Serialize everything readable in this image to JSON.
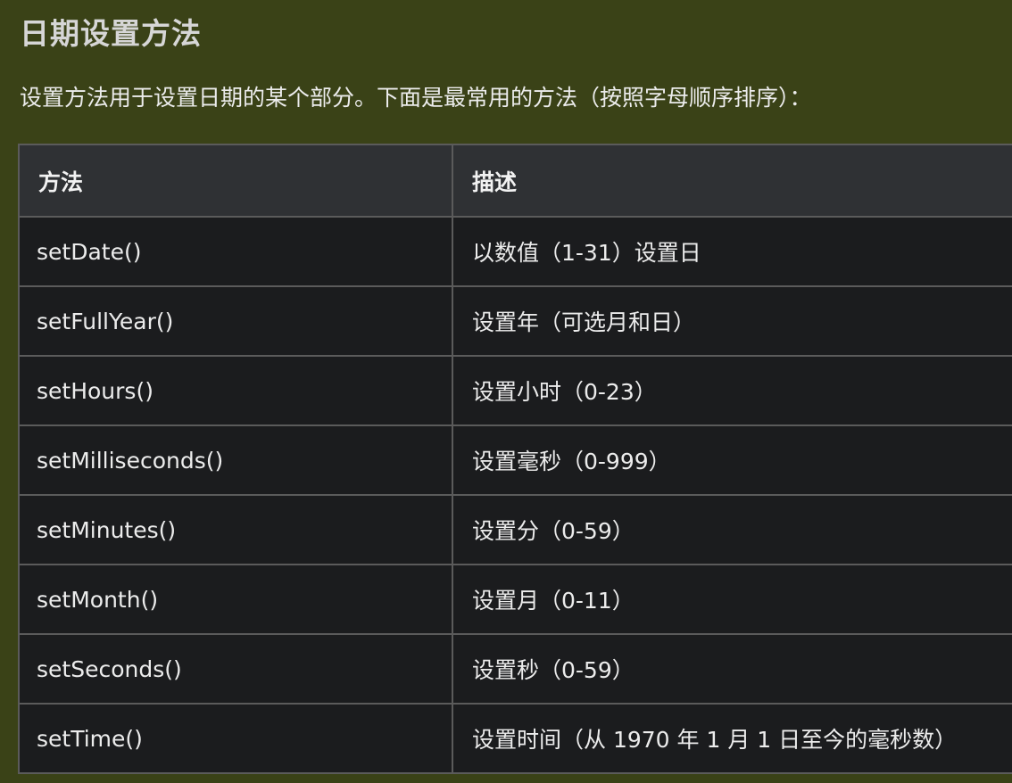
{
  "page": {
    "title": "日期设置方法",
    "intro": "设置方法用于设置日期的某个部分。下面是最常用的方法（按照字母顺序排序）："
  },
  "table": {
    "headers": [
      "方法",
      "描述"
    ],
    "rows": [
      {
        "method": "setDate()",
        "description": "以数值（1-31）设置日"
      },
      {
        "method": "setFullYear()",
        "description": "设置年（可选月和日）"
      },
      {
        "method": "setHours()",
        "description": "设置小时（0-23）"
      },
      {
        "method": "setMilliseconds()",
        "description": "设置毫秒（0-999）"
      },
      {
        "method": "setMinutes()",
        "description": "设置分（0-59）"
      },
      {
        "method": "setMonth()",
        "description": "设置月（0-11）"
      },
      {
        "method": "setSeconds()",
        "description": "设置秒（0-59）"
      },
      {
        "method": "setTime()",
        "description": "设置时间（从 1970 年 1 月 1 日至今的毫秒数）"
      }
    ]
  }
}
